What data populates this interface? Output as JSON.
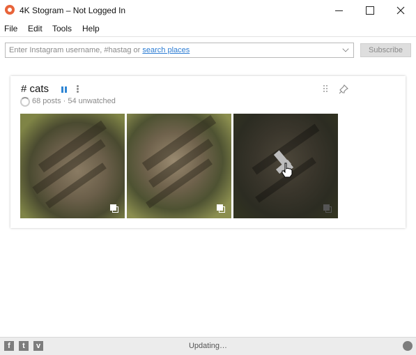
{
  "window": {
    "title": "4K Stogram – Not Logged In",
    "minimize_glyph": "—",
    "maximize_glyph": "☐",
    "close_glyph": "✕"
  },
  "menu": {
    "items": [
      "File",
      "Edit",
      "Tools",
      "Help"
    ]
  },
  "search": {
    "placeholder_prefix": "Enter Instagram username, #hastag or ",
    "link_text": "search places",
    "subscribe_label": "Subscribe"
  },
  "subscription": {
    "title": "# cats",
    "posts": "68 posts",
    "separator": "·",
    "unwatched": "54 unwatched",
    "accent_color": "#2f86d4"
  },
  "statusbar": {
    "social": [
      {
        "name": "facebook-icon",
        "glyph": "f"
      },
      {
        "name": "twitter-icon",
        "glyph": "t"
      },
      {
        "name": "vimeo-icon",
        "glyph": "v"
      }
    ],
    "status_text": "Updating…"
  }
}
